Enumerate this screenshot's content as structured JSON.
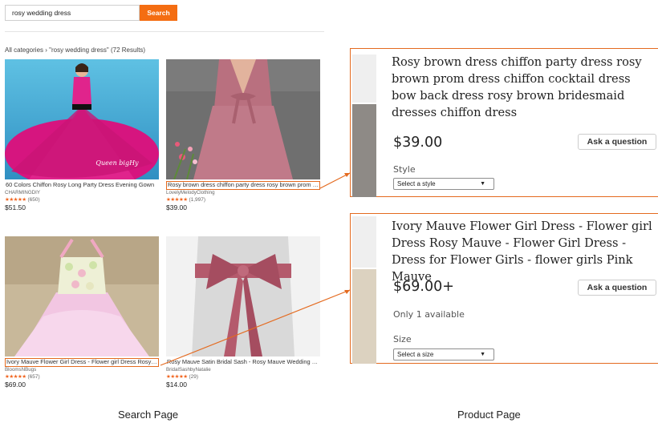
{
  "search": {
    "query": "rosy wedding dress",
    "button_label": "Search"
  },
  "breadcrumb": "All categories › \"rosy wedding dress\" (72 Results)",
  "results": [
    {
      "title": "60 Colors Chiffon Rosy Long Party Dress Evening Gown",
      "shop": "CHARMINGDIY",
      "stars": "★★★★★",
      "reviews": "(650)",
      "price": "$51.50",
      "watermark": "Queen bigHy",
      "highlighted": false
    },
    {
      "title": "Rosy brown dress chiffon party dress rosy brown prom dress",
      "shop": "LovelyMelodyClothing",
      "stars": "★★★★★",
      "reviews": "(1,997)",
      "price": "$39.00",
      "highlighted": true
    },
    {
      "title": "Ivory Mauve Flower Girl Dress - Flower girl Dress Rosy Mauve",
      "shop": "BloomsNBugs",
      "stars": "★★★★★",
      "reviews": "(657)",
      "price": "$69.00",
      "highlighted": true
    },
    {
      "title": "Rosy Mauve Satin Bridal Sash - Rosy Mauve Wedding Sash",
      "shop": "BridalSashbyNatalie",
      "stars": "★★★★★",
      "reviews": "(29)",
      "price": "$14.00",
      "highlighted": false
    }
  ],
  "products": [
    {
      "title": "Rosy brown dress chiffon party dress rosy brown prom dress chiffon cocktail dress bow back dress rosy brown bridesmaid dresses chiffon dress",
      "price": "$39.00",
      "ask_label": "Ask a question",
      "option_label": "Style",
      "select_text": "Select a style",
      "caret": "▼"
    },
    {
      "title": "Ivory Mauve Flower Girl Dress - Flower girl Dress Rosy Mauve - Flower Girl Dress - Dress for Flower Girls - flower girls Pink Mauve",
      "price": "$69.00+",
      "ask_label": "Ask a question",
      "availability": "Only 1 available",
      "option_label": "Size",
      "select_text": "Select a size",
      "caret": "▼"
    }
  ],
  "captions": {
    "left": "Search Page",
    "right": "Product Page"
  },
  "colors": {
    "accent": "#f46d12",
    "highlight_border": "#e46a1f",
    "stars": "#f1641e"
  }
}
